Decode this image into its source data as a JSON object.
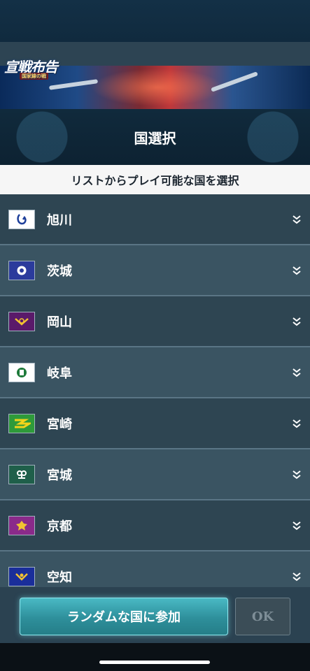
{
  "logo": {
    "text": "宣戦布告",
    "sub": "国家線の戦"
  },
  "header": {
    "title": "国選択"
  },
  "subtitle": "リストからプレイ可能な国を選択",
  "countries": [
    {
      "name": "旭川",
      "flag": "asahikawa-flag-icon"
    },
    {
      "name": "茨城",
      "flag": "ibaraki-flag-icon"
    },
    {
      "name": "岡山",
      "flag": "okayama-flag-icon"
    },
    {
      "name": "岐阜",
      "flag": "gifu-flag-icon"
    },
    {
      "name": "宮崎",
      "flag": "miyazaki-flag-icon"
    },
    {
      "name": "宮城",
      "flag": "miyagi-flag-icon"
    },
    {
      "name": "京都",
      "flag": "kyoto-flag-icon"
    },
    {
      "name": "空知",
      "flag": "sorachi-flag-icon"
    }
  ],
  "buttons": {
    "random_join": "ランダムな国に参加",
    "ok": "OK"
  },
  "colors": {
    "accent": "#3aa7b3",
    "row_dark": "#2e4552",
    "row_light": "#3a5462"
  }
}
